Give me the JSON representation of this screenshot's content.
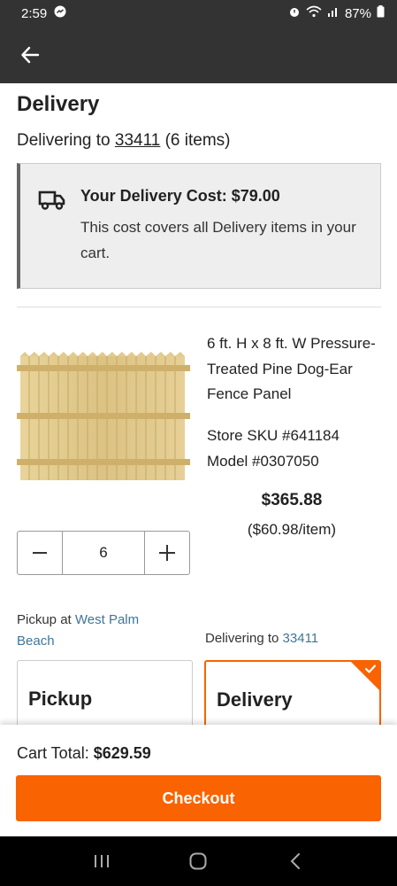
{
  "status_bar": {
    "time": "2:59",
    "battery": "87%"
  },
  "icons": {
    "back": "arrow-left-icon",
    "truck": "truck-icon",
    "minus": "minus-icon",
    "plus": "plus-icon",
    "check": "check-icon"
  },
  "delivery": {
    "title": "Delivery",
    "delivering_prefix": "Delivering to ",
    "zip": "33411",
    "items_count": " (6 items)",
    "cost_title": "Your Delivery Cost: $79.00",
    "cost_desc": "This cost covers all Delivery items in your cart."
  },
  "product": {
    "name": "6 ft. H x 8 ft. W Pressure-Treated Pine Dog-Ear Fence Panel",
    "store_sku": "Store SKU #641184",
    "model": "Model #0307050",
    "price": "$365.88",
    "unit_price": "($60.98/item)",
    "quantity": "6"
  },
  "fulfillment": {
    "pickup_prefix": "Pickup at ",
    "pickup_store": "West Palm Beach",
    "delivering_prefix": "Delivering to ",
    "delivering_zip": "33411",
    "pickup_label": "Pickup",
    "delivery_label": "Delivery"
  },
  "footer": {
    "cart_total_label": "Cart Total: ",
    "cart_total_value": "$629.59",
    "checkout_label": "Checkout"
  },
  "colors": {
    "brand_orange": "#f96302",
    "link_blue": "#3e7697",
    "header_dark": "#333333"
  }
}
